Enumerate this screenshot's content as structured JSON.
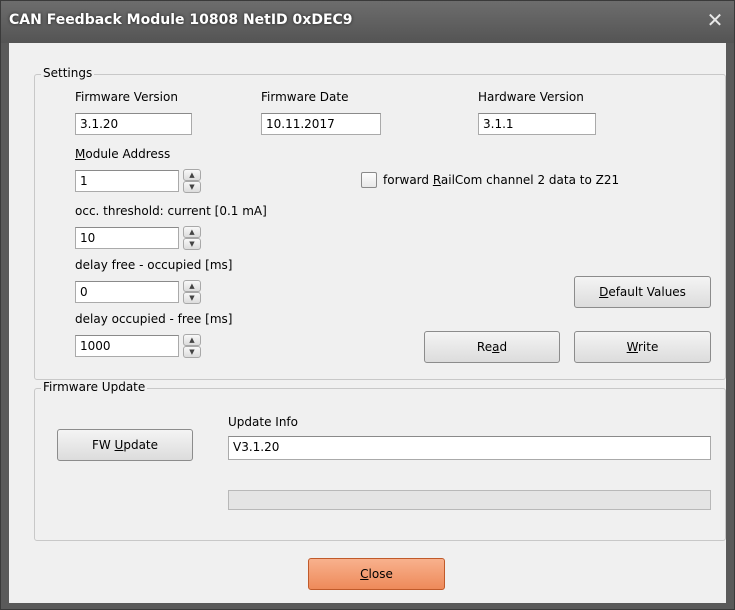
{
  "window": {
    "title": "CAN Feedback Module 10808 NetID 0xDEC9",
    "close_glyph": "✕"
  },
  "settings": {
    "legend": "Settings",
    "firmware_version": {
      "label": "Firmware Version",
      "value": "3.1.20"
    },
    "firmware_date": {
      "label": "Firmware Date",
      "value": "10.11.2017"
    },
    "hardware_version": {
      "label": "Hardware Version",
      "value": "3.1.1"
    },
    "module_address": {
      "label_pre": "",
      "label_ul": "M",
      "label_post": "odule Address",
      "value": "1"
    },
    "occ_threshold": {
      "label": "occ. threshold: current [0.1 mA]",
      "value": "10"
    },
    "delay_free_occupied": {
      "label": "delay free - occupied [ms]",
      "value": "0"
    },
    "delay_occupied_free": {
      "label": "delay occupied - free [ms]",
      "value": "1000"
    },
    "railcom_checkbox": {
      "label_pre": "forward ",
      "label_ul": "R",
      "label_post": "ailCom channel 2 data to Z21",
      "checked": false
    },
    "default_values_button": {
      "pre": "",
      "ul": "D",
      "post": "efault Values"
    },
    "read_button": {
      "pre": "Re",
      "ul": "a",
      "post": "d"
    },
    "write_button": {
      "pre": "",
      "ul": "W",
      "post": "rite"
    }
  },
  "firmware_update": {
    "legend": "Firmware Update",
    "fw_update_button": {
      "pre": "FW ",
      "ul": "U",
      "post": "pdate"
    },
    "update_info_label": "Update Info",
    "update_info_value": "V3.1.20",
    "progress": 0
  },
  "footer": {
    "close_button": {
      "pre": "",
      "ul": "C",
      "post": "lose"
    }
  },
  "icons": {
    "spin_up": "▲",
    "spin_down": "▼"
  },
  "colors": {
    "close_button_accent": "#ee8a5a",
    "titlebar": "#5a5a5a"
  }
}
